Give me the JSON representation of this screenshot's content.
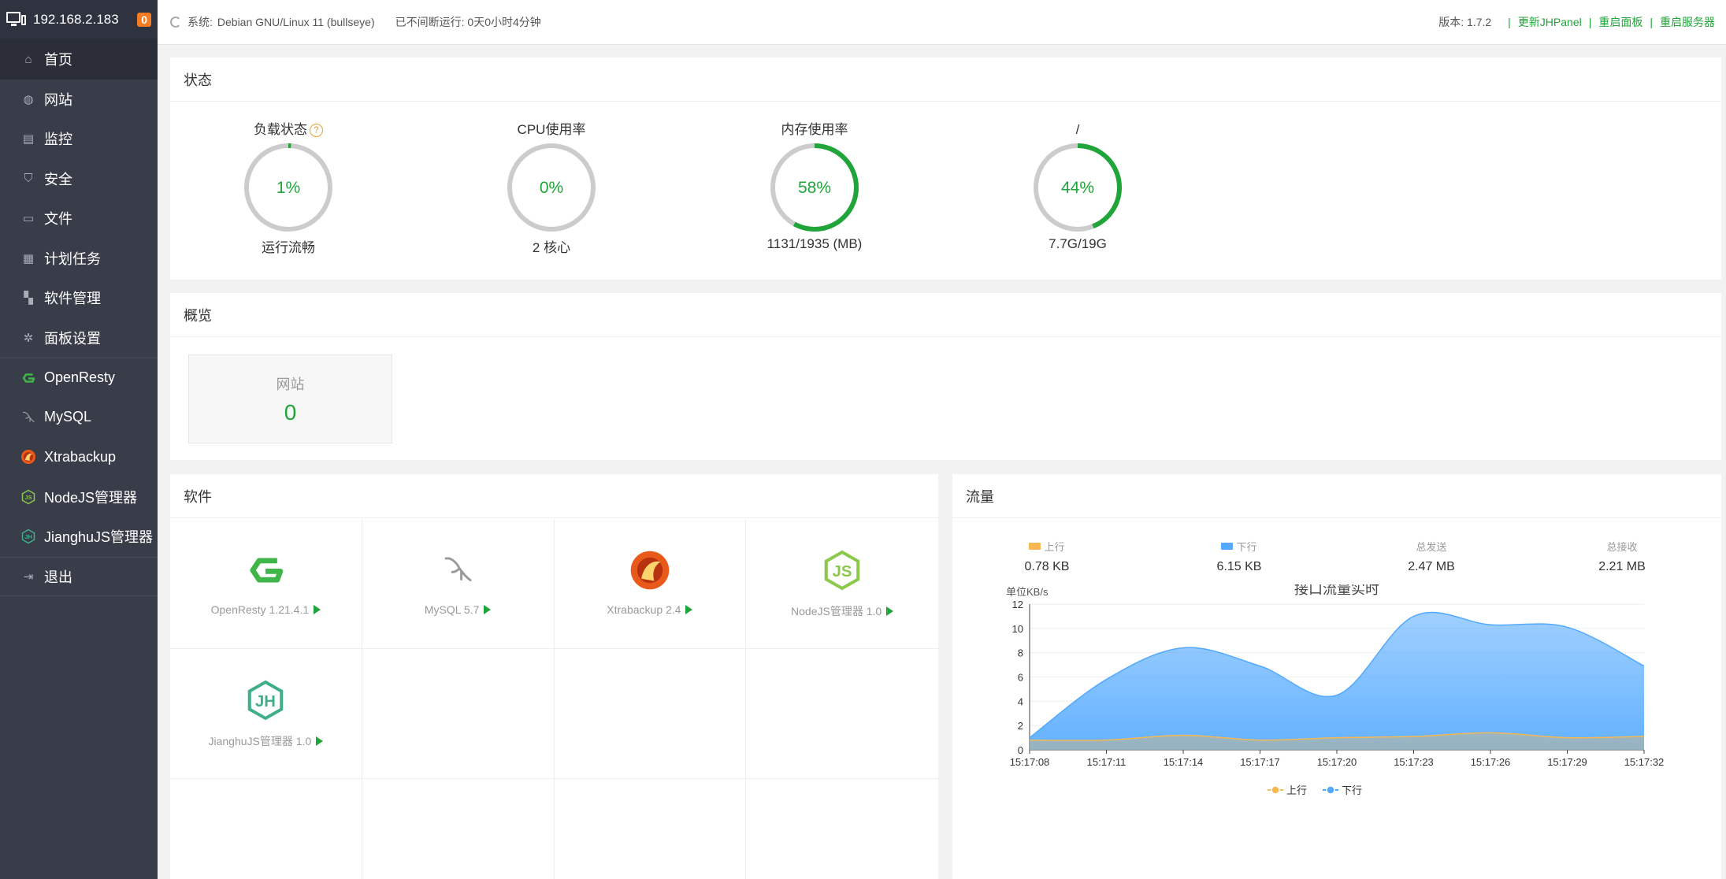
{
  "sidebar": {
    "host": "192.168.2.183",
    "badge": "0",
    "items": [
      {
        "label": "首页",
        "icon": "home-icon",
        "active": true
      },
      {
        "label": "网站",
        "icon": "globe-icon"
      },
      {
        "label": "监控",
        "icon": "monitor-icon"
      },
      {
        "label": "安全",
        "icon": "shield-icon"
      },
      {
        "label": "文件",
        "icon": "folder-icon"
      },
      {
        "label": "计划任务",
        "icon": "calendar-icon"
      },
      {
        "label": "软件管理",
        "icon": "apps-icon"
      },
      {
        "label": "面板设置",
        "icon": "gear-icon"
      }
    ],
    "plugins": [
      {
        "label": "OpenResty",
        "icon": "openresty-icon"
      },
      {
        "label": "MySQL",
        "icon": "mysql-icon"
      },
      {
        "label": "Xtrabackup",
        "icon": "xtrabackup-icon"
      },
      {
        "label": "NodeJS管理器",
        "icon": "nodejs-icon"
      },
      {
        "label": "JianghuJS管理器",
        "icon": "jianghujs-icon"
      }
    ],
    "logout": "退出"
  },
  "topbar": {
    "system_label": "系统:",
    "system_value": "Debian GNU/Linux 11 (bullseye)",
    "uptime": "已不间断运行: 0天0小时4分钟",
    "version": "版本: 1.7.2",
    "links": [
      "更新JHPanel",
      "重启面板",
      "重启服务器"
    ]
  },
  "status": {
    "title": "状态",
    "gauges": [
      {
        "label": "负载状态",
        "value": "1%",
        "sub": "运行流畅",
        "percent": 1,
        "help": "?"
      },
      {
        "label": "CPU使用率",
        "value": "0%",
        "sub": "2 核心",
        "percent": 0
      },
      {
        "label": "内存使用率",
        "value": "58%",
        "sub": "1131/1935 (MB)",
        "percent": 58
      },
      {
        "label": "/",
        "value": "44%",
        "sub": "7.7G/19G",
        "percent": 44
      }
    ],
    "colors": {
      "ok": "#20a53a",
      "track": "#cccccc"
    }
  },
  "overview": {
    "title": "概览",
    "card": {
      "label": "网站",
      "value": "0"
    }
  },
  "software": {
    "title": "软件",
    "items": [
      {
        "name": "OpenResty 1.21.4.1",
        "icon": "openresty-icon"
      },
      {
        "name": "MySQL 5.7",
        "icon": "mysql-icon"
      },
      {
        "name": "Xtrabackup 2.4",
        "icon": "xtrabackup-icon"
      },
      {
        "name": "NodeJS管理器 1.0",
        "icon": "nodejs-icon"
      },
      {
        "name": "JianghuJS管理器 1.0",
        "icon": "jianghujs-icon"
      }
    ]
  },
  "traffic": {
    "title": "流量",
    "stats": [
      {
        "label": "上行",
        "value": "0.78 KB",
        "color": "#f7b851"
      },
      {
        "label": "下行",
        "value": "6.15 KB",
        "color": "#52a9ff"
      },
      {
        "label": "总发送",
        "value": "2.47 MB"
      },
      {
        "label": "总接收",
        "value": "2.21 MB"
      }
    ]
  },
  "chart_data": {
    "type": "area",
    "title": "接口流量实时",
    "ylabel": "单位KB/s",
    "ylim": [
      0,
      12
    ],
    "yticks": [
      0,
      2,
      4,
      6,
      8,
      10,
      12
    ],
    "x": [
      "15:17:08",
      "15:17:11",
      "15:17:14",
      "15:17:17",
      "15:17:20",
      "15:17:23",
      "15:17:26",
      "15:17:29",
      "15:17:32"
    ],
    "series": [
      {
        "name": "上行",
        "color": "#f7b851",
        "values": [
          0.8,
          0.8,
          1.2,
          0.8,
          1.0,
          1.1,
          1.4,
          1.0,
          1.1
        ]
      },
      {
        "name": "下行",
        "color": "#52a9ff",
        "values": [
          1.0,
          5.8,
          8.4,
          6.9,
          4.5,
          11.0,
          10.3,
          10.1,
          6.9
        ]
      }
    ],
    "legend": "bottom",
    "grid": true
  }
}
